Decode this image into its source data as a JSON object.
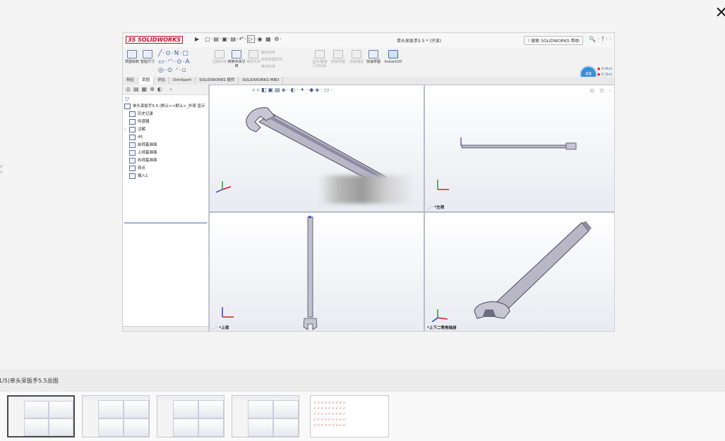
{
  "viewer": {
    "caption": "1/5)单头呆扳手5.5总图",
    "thumbnail_count": 5,
    "active_thumbnail": 1
  },
  "app": {
    "logo": "SOLIDWORKS",
    "doc_title": "单头呆扳手5.5 * (只读)",
    "search_placeholder": "搜索 SOLIDWORKS 帮助",
    "gauge_value": "49",
    "stat1": "0.4k/s",
    "stat2": "0.1k/s"
  },
  "ribbon": {
    "buttons": [
      {
        "label": "草图绘制"
      },
      {
        "label": "智能尺寸"
      },
      {
        "label": "剪裁实体"
      },
      {
        "label": "转换实体引用"
      },
      {
        "label": "等距实体"
      },
      {
        "label": "镜向实体"
      },
      {
        "label": "线性草图阵列"
      },
      {
        "label": "移动实体"
      },
      {
        "label": "显示/删除几何关系"
      },
      {
        "label": "修复草图"
      },
      {
        "label": "快速捕捉"
      },
      {
        "label": "快速草图"
      },
      {
        "label": "Instant2D"
      }
    ]
  },
  "tabs": [
    "特征",
    "草图",
    "评估",
    "DimXpert",
    "SOLIDWORKS 插件",
    "SOLIDWORKS MBD"
  ],
  "active_tab": "草图",
  "tree": {
    "root": "单头呆扳手5.5 (默认<<默认>_外观 显示",
    "items": [
      {
        "label": "历史记录",
        "icon": "history-icon"
      },
      {
        "label": "传感器",
        "icon": "sensor-icon"
      },
      {
        "label": "注解",
        "icon": "annotation-icon",
        "expandable": true
      },
      {
        "label": "45",
        "icon": "material-icon"
      },
      {
        "label": "前视基准面",
        "icon": "plane-icon"
      },
      {
        "label": "上视基准面",
        "icon": "plane-icon"
      },
      {
        "label": "右视基准面",
        "icon": "plane-icon"
      },
      {
        "label": "原点",
        "icon": "origin-icon"
      },
      {
        "label": "输入1",
        "icon": "import-icon"
      }
    ]
  },
  "viewports": {
    "top_left": "",
    "top_right": "*左视",
    "bottom_left": "*上视",
    "bottom_right": "*上下二等角轴测"
  },
  "colors": {
    "wrench_fill": "#b9b6c6",
    "wrench_edge": "#4a4860",
    "triad_x": "#d42020",
    "triad_y": "#2a9a2a",
    "triad_z": "#2a3fd0",
    "accent": "#3a6fb0"
  },
  "thumb5_text": "✓✓✓✓✓✓✓✓✓"
}
